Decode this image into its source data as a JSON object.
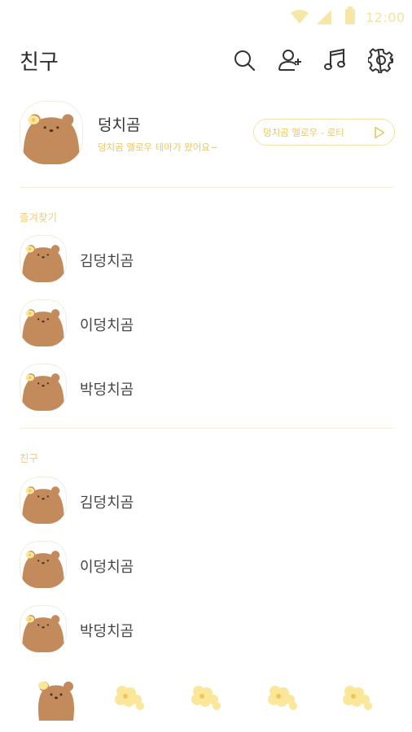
{
  "status_bar": {
    "time": "12:00",
    "icons": [
      "wifi-icon",
      "cellular-signal-icon",
      "battery-icon"
    ],
    "accent_color": "#f3e2a0"
  },
  "header": {
    "title": "친구",
    "icons": [
      "search-icon",
      "add-friend-icon",
      "music-note-icon",
      "settings-gear-icon"
    ]
  },
  "profile": {
    "name": "덩치곰",
    "status_message": "덩치곰 멜로우 테마가 왔어요~",
    "music_label": "덩치곰 멜로우 - 로티",
    "avatar_icon": "brown-bear-avatar"
  },
  "favorites": {
    "label": "즐겨찾기",
    "items": [
      {
        "name": "김덩치곰"
      },
      {
        "name": "이덩치곰"
      },
      {
        "name": "박덩치곰"
      }
    ]
  },
  "friends": {
    "label": "친구",
    "items": [
      {
        "name": "김덩치곰"
      },
      {
        "name": "이덩치곰"
      },
      {
        "name": "박덩치곰"
      }
    ]
  },
  "bottom_nav": {
    "tabs": [
      "bear-friends-tab-icon",
      "flower-chat-tab-icon",
      "flower-view-tab-icon",
      "flower-shop-tab-icon",
      "flower-more-tab-icon"
    ]
  },
  "colors": {
    "bear_brown": "#c38a5c",
    "accent_yellow": "#efce78",
    "flower_yellow": "#fbe79a"
  }
}
